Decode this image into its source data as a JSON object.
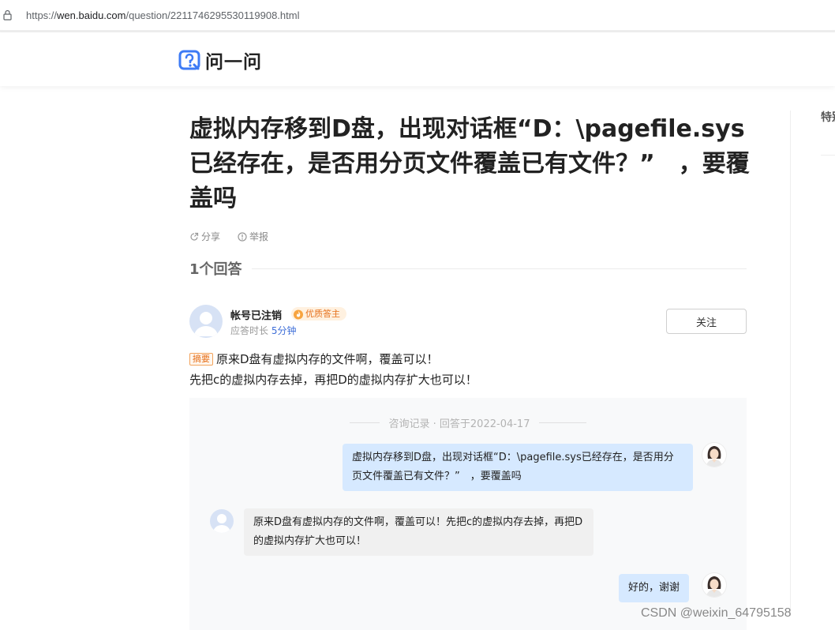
{
  "browser": {
    "url_prefix": "https://",
    "url_host": "wen.baidu.com",
    "url_path": "/question/2211746295530119908.html"
  },
  "site": {
    "logo_text": "问一问"
  },
  "sidebar": {
    "peek_text": "特别"
  },
  "question": {
    "title": "虚拟内存移到D盘，出现对话框“D：\\pagefile.sys已经存在，是否用分页文件覆盖已有文件？”　，要覆盖吗",
    "actions": {
      "share": "分享",
      "report": "举报"
    }
  },
  "answers": {
    "count_label": "1个回答"
  },
  "answer": {
    "user_name": "帐号已注销",
    "badge": "优质答主",
    "response_label": "应答时长",
    "response_value": "5分钟",
    "follow_label": "关注",
    "summary_tag": "摘要",
    "summary_line1": "原来D盘有虚拟内存的文件啊，覆盖可以！",
    "summary_line2": "先把c的虚拟内存去掉，再把D的虚拟内存扩大也可以！"
  },
  "consult": {
    "header": "咨询记录 · 回答于2022-04-17",
    "messages": [
      {
        "role": "asker",
        "text": "虚拟内存移到D盘，出现对话框“D：\\pagefile.sys已经存在，是否用分页文件覆盖已有文件？”　，要覆盖吗"
      },
      {
        "role": "answerer",
        "text": "原来D盘有虚拟内存的文件啊，覆盖可以！先把c的虚拟内存去掉，再把D的虚拟内存扩大也可以！"
      },
      {
        "role": "asker",
        "text": "好的，谢谢"
      }
    ]
  },
  "watermark": "CSDN @weixin_64795158",
  "colors": {
    "accent_blue": "#3f6fd8",
    "badge_orange": "#e6711c",
    "bubble_me": "#d6e9ff",
    "bubble_them": "#f0f0f0"
  },
  "icons": [
    "lock-icon",
    "logo-icon",
    "share-icon",
    "report-icon",
    "badge-flame-icon",
    "avatar-icon"
  ]
}
